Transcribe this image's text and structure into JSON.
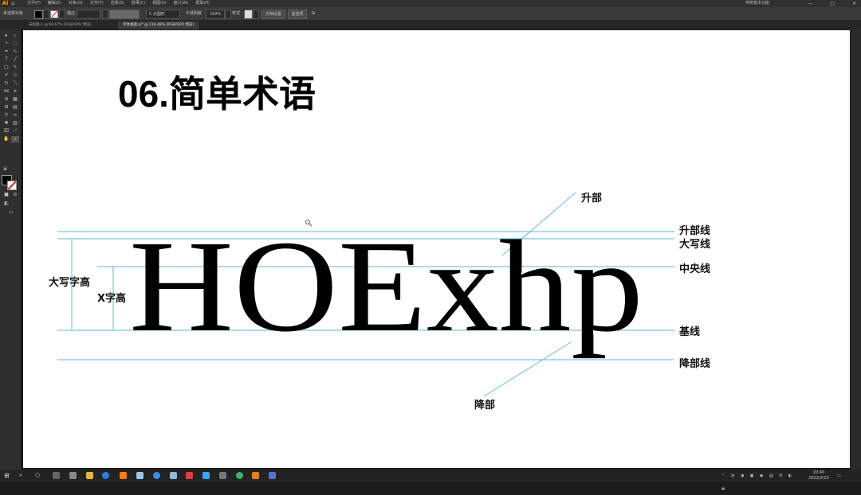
{
  "app": {
    "logo": "Ai",
    "menus": [
      "文件(F)",
      "编辑(E)",
      "对象(O)",
      "文字(T)",
      "选择(S)",
      "效果(C)",
      "视图(V)",
      "窗口(W)",
      "帮助(H)"
    ],
    "workspace": "传统基本功能",
    "window_controls": [
      "—",
      "□",
      "✕"
    ]
  },
  "control_bar": {
    "selection_label": "未选择对象",
    "stroke_label": "描边",
    "brush_label": "5 点圆形",
    "opacity_label": "不透明度",
    "opacity_value": "100%",
    "style_label": "样式",
    "doc_setup_button": "文档设置",
    "prefs_button": "首选项"
  },
  "tabs": [
    {
      "label": "未标题-1 @ 66.67% (RGB/GPU 预览)",
      "active": false
    },
    {
      "label": "字体基础.ai* @ 116.48% (RGB/GPU 预览)",
      "active": true
    }
  ],
  "artboard": {
    "heading": "06.简单术语",
    "specimen": "HOExhp",
    "labels": {
      "ascender": "升部",
      "descender": "降部",
      "ascender_line": "升部线",
      "cap_line": "大写线",
      "mean_line": "中央线",
      "baseline": "基线",
      "descender_line": "降部线",
      "cap_height": "大写字高",
      "x_height": "X字高"
    },
    "guide_color": "#5bb8e6"
  },
  "taskbar": {
    "time": "20:40",
    "date": "2022/2/23"
  }
}
